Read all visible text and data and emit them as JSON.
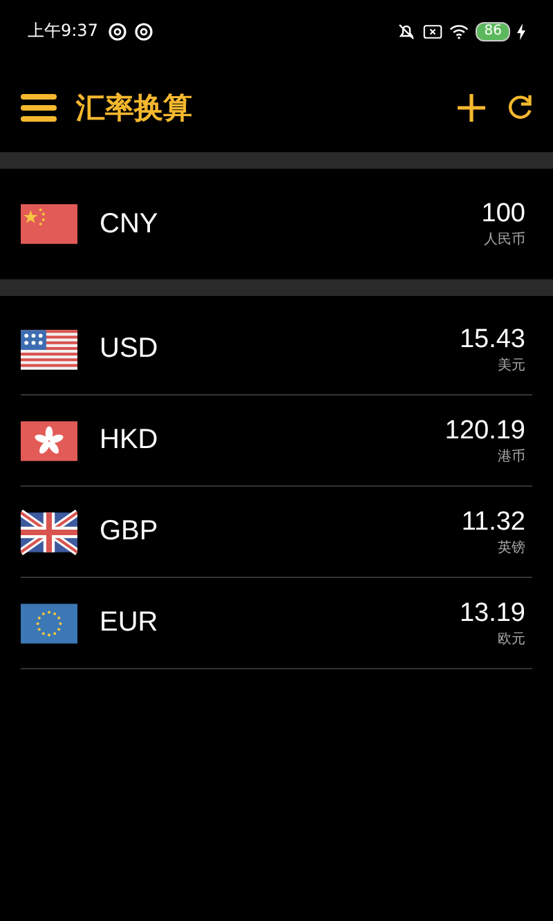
{
  "status_bar": {
    "time": "上午9:37",
    "battery": "86"
  },
  "header": {
    "title": "汇率换算"
  },
  "base": {
    "kind": "cn",
    "code": "CNY",
    "amount": "100",
    "name": "人民币"
  },
  "currencies": [
    {
      "kind": "us",
      "code": "USD",
      "amount": "15.43",
      "name": "美元"
    },
    {
      "kind": "hk",
      "code": "HKD",
      "amount": "120.19",
      "name": "港币"
    },
    {
      "kind": "gb",
      "code": "GBP",
      "amount": "11.32",
      "name": "英镑"
    },
    {
      "kind": "eu",
      "code": "EUR",
      "amount": "13.19",
      "name": "欧元"
    }
  ]
}
